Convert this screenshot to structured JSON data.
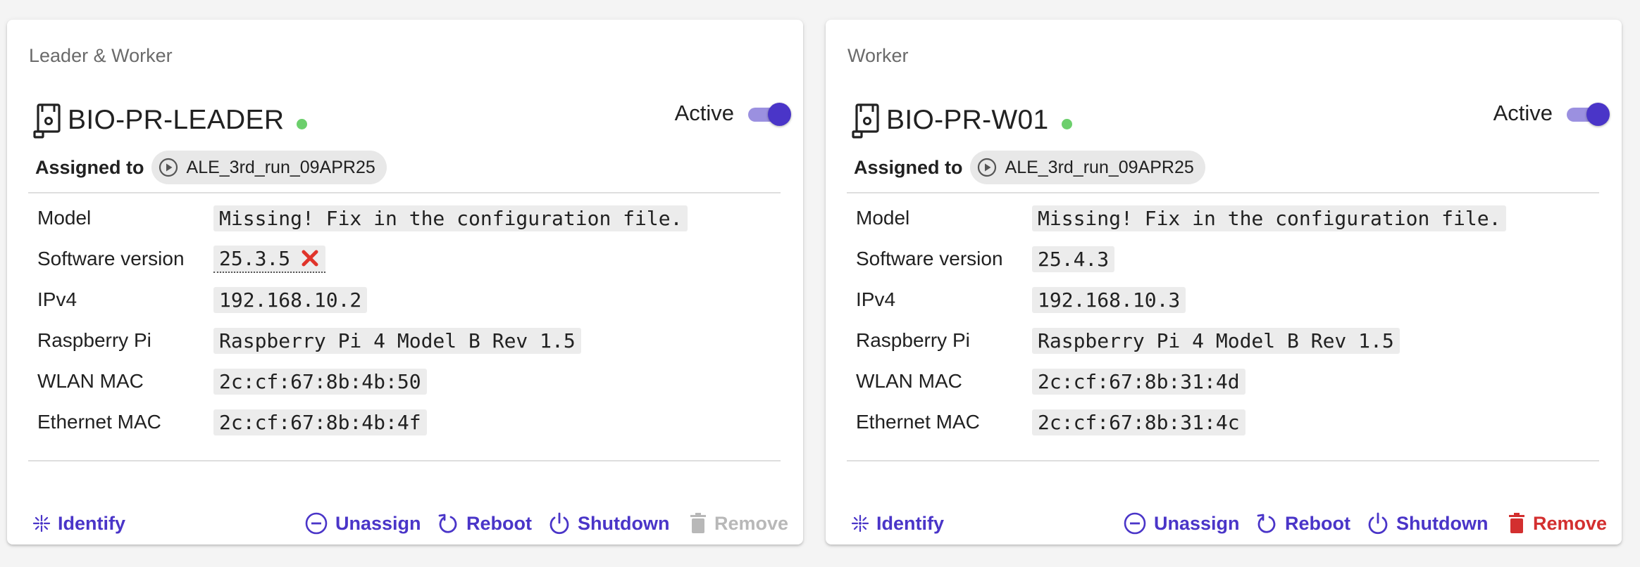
{
  "devices": [
    {
      "role": "Leader & Worker",
      "name": "BIO-PR-LEADER",
      "status_color": "#6ccf6c",
      "active_label": "Active",
      "active": true,
      "assigned_label": "Assigned to",
      "assigned_run": "ALE_3rd_run_09APR25",
      "info": [
        {
          "label": "Model",
          "value": "Missing! Fix in the configuration file."
        },
        {
          "label": "Software version",
          "value": "25.3.5",
          "warning_icon": "red-x-icon"
        },
        {
          "label": "IPv4",
          "value": "192.168.10.2"
        },
        {
          "label": "Raspberry Pi",
          "value": "Raspberry Pi 4 Model B Rev 1.5"
        },
        {
          "label": "WLAN MAC",
          "value": "2c:cf:67:8b:4b:50"
        },
        {
          "label": "Ethernet MAC",
          "value": "2c:cf:67:8b:4b:4f"
        }
      ],
      "actions": {
        "identify": "Identify",
        "unassign": "Unassign",
        "reboot": "Reboot",
        "shutdown": "Shutdown",
        "remove": "Remove",
        "remove_enabled": false
      }
    },
    {
      "role": "Worker",
      "name": "BIO-PR-W01",
      "status_color": "#6ccf6c",
      "active_label": "Active",
      "active": true,
      "assigned_label": "Assigned to",
      "assigned_run": "ALE_3rd_run_09APR25",
      "info": [
        {
          "label": "Model",
          "value": "Missing! Fix in the configuration file."
        },
        {
          "label": "Software version",
          "value": "25.4.3"
        },
        {
          "label": "IPv4",
          "value": "192.168.10.3"
        },
        {
          "label": "Raspberry Pi",
          "value": "Raspberry Pi 4 Model B Rev 1.5"
        },
        {
          "label": "WLAN MAC",
          "value": "2c:cf:67:8b:31:4d"
        },
        {
          "label": "Ethernet MAC",
          "value": "2c:cf:67:8b:31:4c"
        }
      ],
      "actions": {
        "identify": "Identify",
        "unassign": "Unassign",
        "reboot": "Reboot",
        "shutdown": "Shutdown",
        "remove": "Remove",
        "remove_enabled": true
      }
    }
  ],
  "colors": {
    "accent": "#4a35c8",
    "danger": "#d32f2f",
    "disabled": "#b8b8b8",
    "toggle_track": "#9b90e0"
  }
}
